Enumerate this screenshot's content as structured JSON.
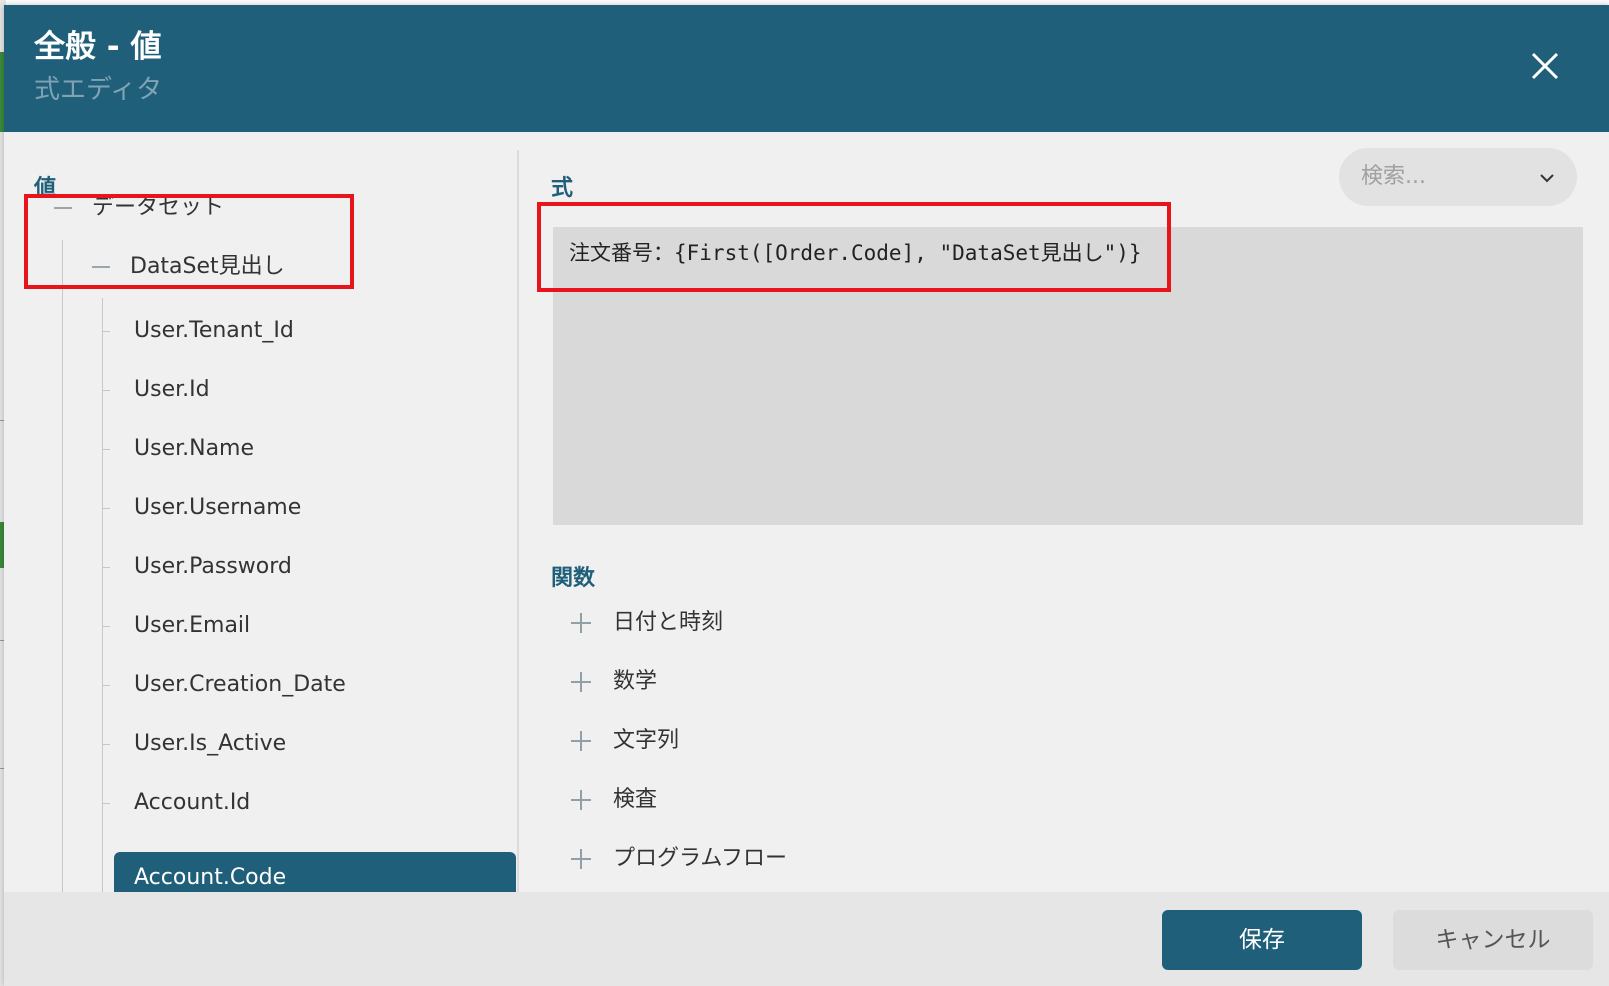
{
  "dialog": {
    "title": "全般 - 値",
    "subtitle": "式エディタ",
    "close_icon": "close-icon"
  },
  "left_panel": {
    "label": "値",
    "tree": {
      "root_label": "データセット",
      "dataset_label": "DataSet見出し",
      "fields": [
        "User.Tenant_Id",
        "User.Id",
        "User.Name",
        "User.Username",
        "User.Password",
        "User.Email",
        "User.Creation_Date",
        "User.Is_Active",
        "Account.Id"
      ],
      "selected_field": "Account.Code"
    }
  },
  "right_panel": {
    "expression_label": "式",
    "search_placeholder": "検索...",
    "expression_text": "注文番号：{First([Order.Code], \"DataSet見出し\")}",
    "functions_label": "関数",
    "function_groups": [
      "日付と時刻",
      "数学",
      "文字列",
      "検査",
      "プログラムフロー"
    ]
  },
  "footer": {
    "save_label": "保存",
    "cancel_label": "キャンセル"
  },
  "colors": {
    "header": "#1f5f7a",
    "highlight_box": "#e8141b",
    "selected_item": "#1f5f7a"
  }
}
